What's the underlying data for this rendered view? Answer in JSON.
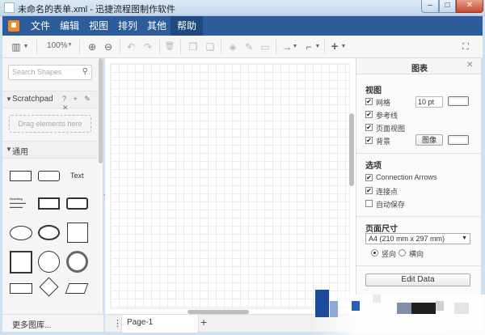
{
  "window": {
    "title": "未命名的表单.xml - 迅捷流程图制作软件",
    "min_symbol": "–",
    "max_symbol": "□",
    "close_symbol": "✕"
  },
  "menubar": {
    "items": [
      "文件",
      "编辑",
      "视图",
      "排列",
      "其他",
      "帮助"
    ],
    "active": "帮助"
  },
  "toolbar": {
    "zoom": "100%",
    "icons": {
      "pages": "▥",
      "zoom_in": "⊕",
      "zoom_out": "⊖",
      "undo": "↶",
      "redo": "↷",
      "delete": "🗑",
      "to_front": "❐",
      "to_back": "❏",
      "fill": "◈",
      "line": "✎",
      "shadow": "▭",
      "connector": "→",
      "waypoint": "⌐",
      "insert": "+",
      "fullscreen": "⛶"
    }
  },
  "sidebar": {
    "search_placeholder": "Search Shapes",
    "search_icon": "⚲",
    "scratchpad_title": "Scratchpad",
    "scratchpad_icons": "? + ✎ ✕",
    "dropzone_text": "Drag elements here",
    "general_title": "通用",
    "text_shape_label": "Text",
    "heading_shape_label": "Heading",
    "more_libraries": "更多图库..."
  },
  "pagebar": {
    "menu_icon": "⋮",
    "page_name": "Page-1",
    "add_icon": "+"
  },
  "format_panel": {
    "title": "图表",
    "close_icon": "✕",
    "view_section": "视图",
    "grid_label": "网格",
    "grid_size": "10 pt",
    "guides_label": "参考线",
    "page_view_label": "页面视图",
    "background_label": "背景",
    "image_button": "图像",
    "options_section": "选项",
    "connection_arrows_label": "Connection Arrows",
    "connection_points_label": "连接点",
    "autosave_label": "自动保存",
    "page_size_section": "页面尺寸",
    "page_size_value": "A4 (210 mm x 297 mm)",
    "portrait_label": "竖向",
    "landscape_label": "横向",
    "edit_data_button": "Edit Data",
    "checked": {
      "grid": true,
      "guides": true,
      "page_view": true,
      "background": true,
      "connection_arrows": true,
      "connection_points": true,
      "autosave": false
    }
  },
  "colors": {
    "menubar": "#2c5d9a",
    "menubar_active": "#1f4a80",
    "logo": "#f08a24"
  }
}
